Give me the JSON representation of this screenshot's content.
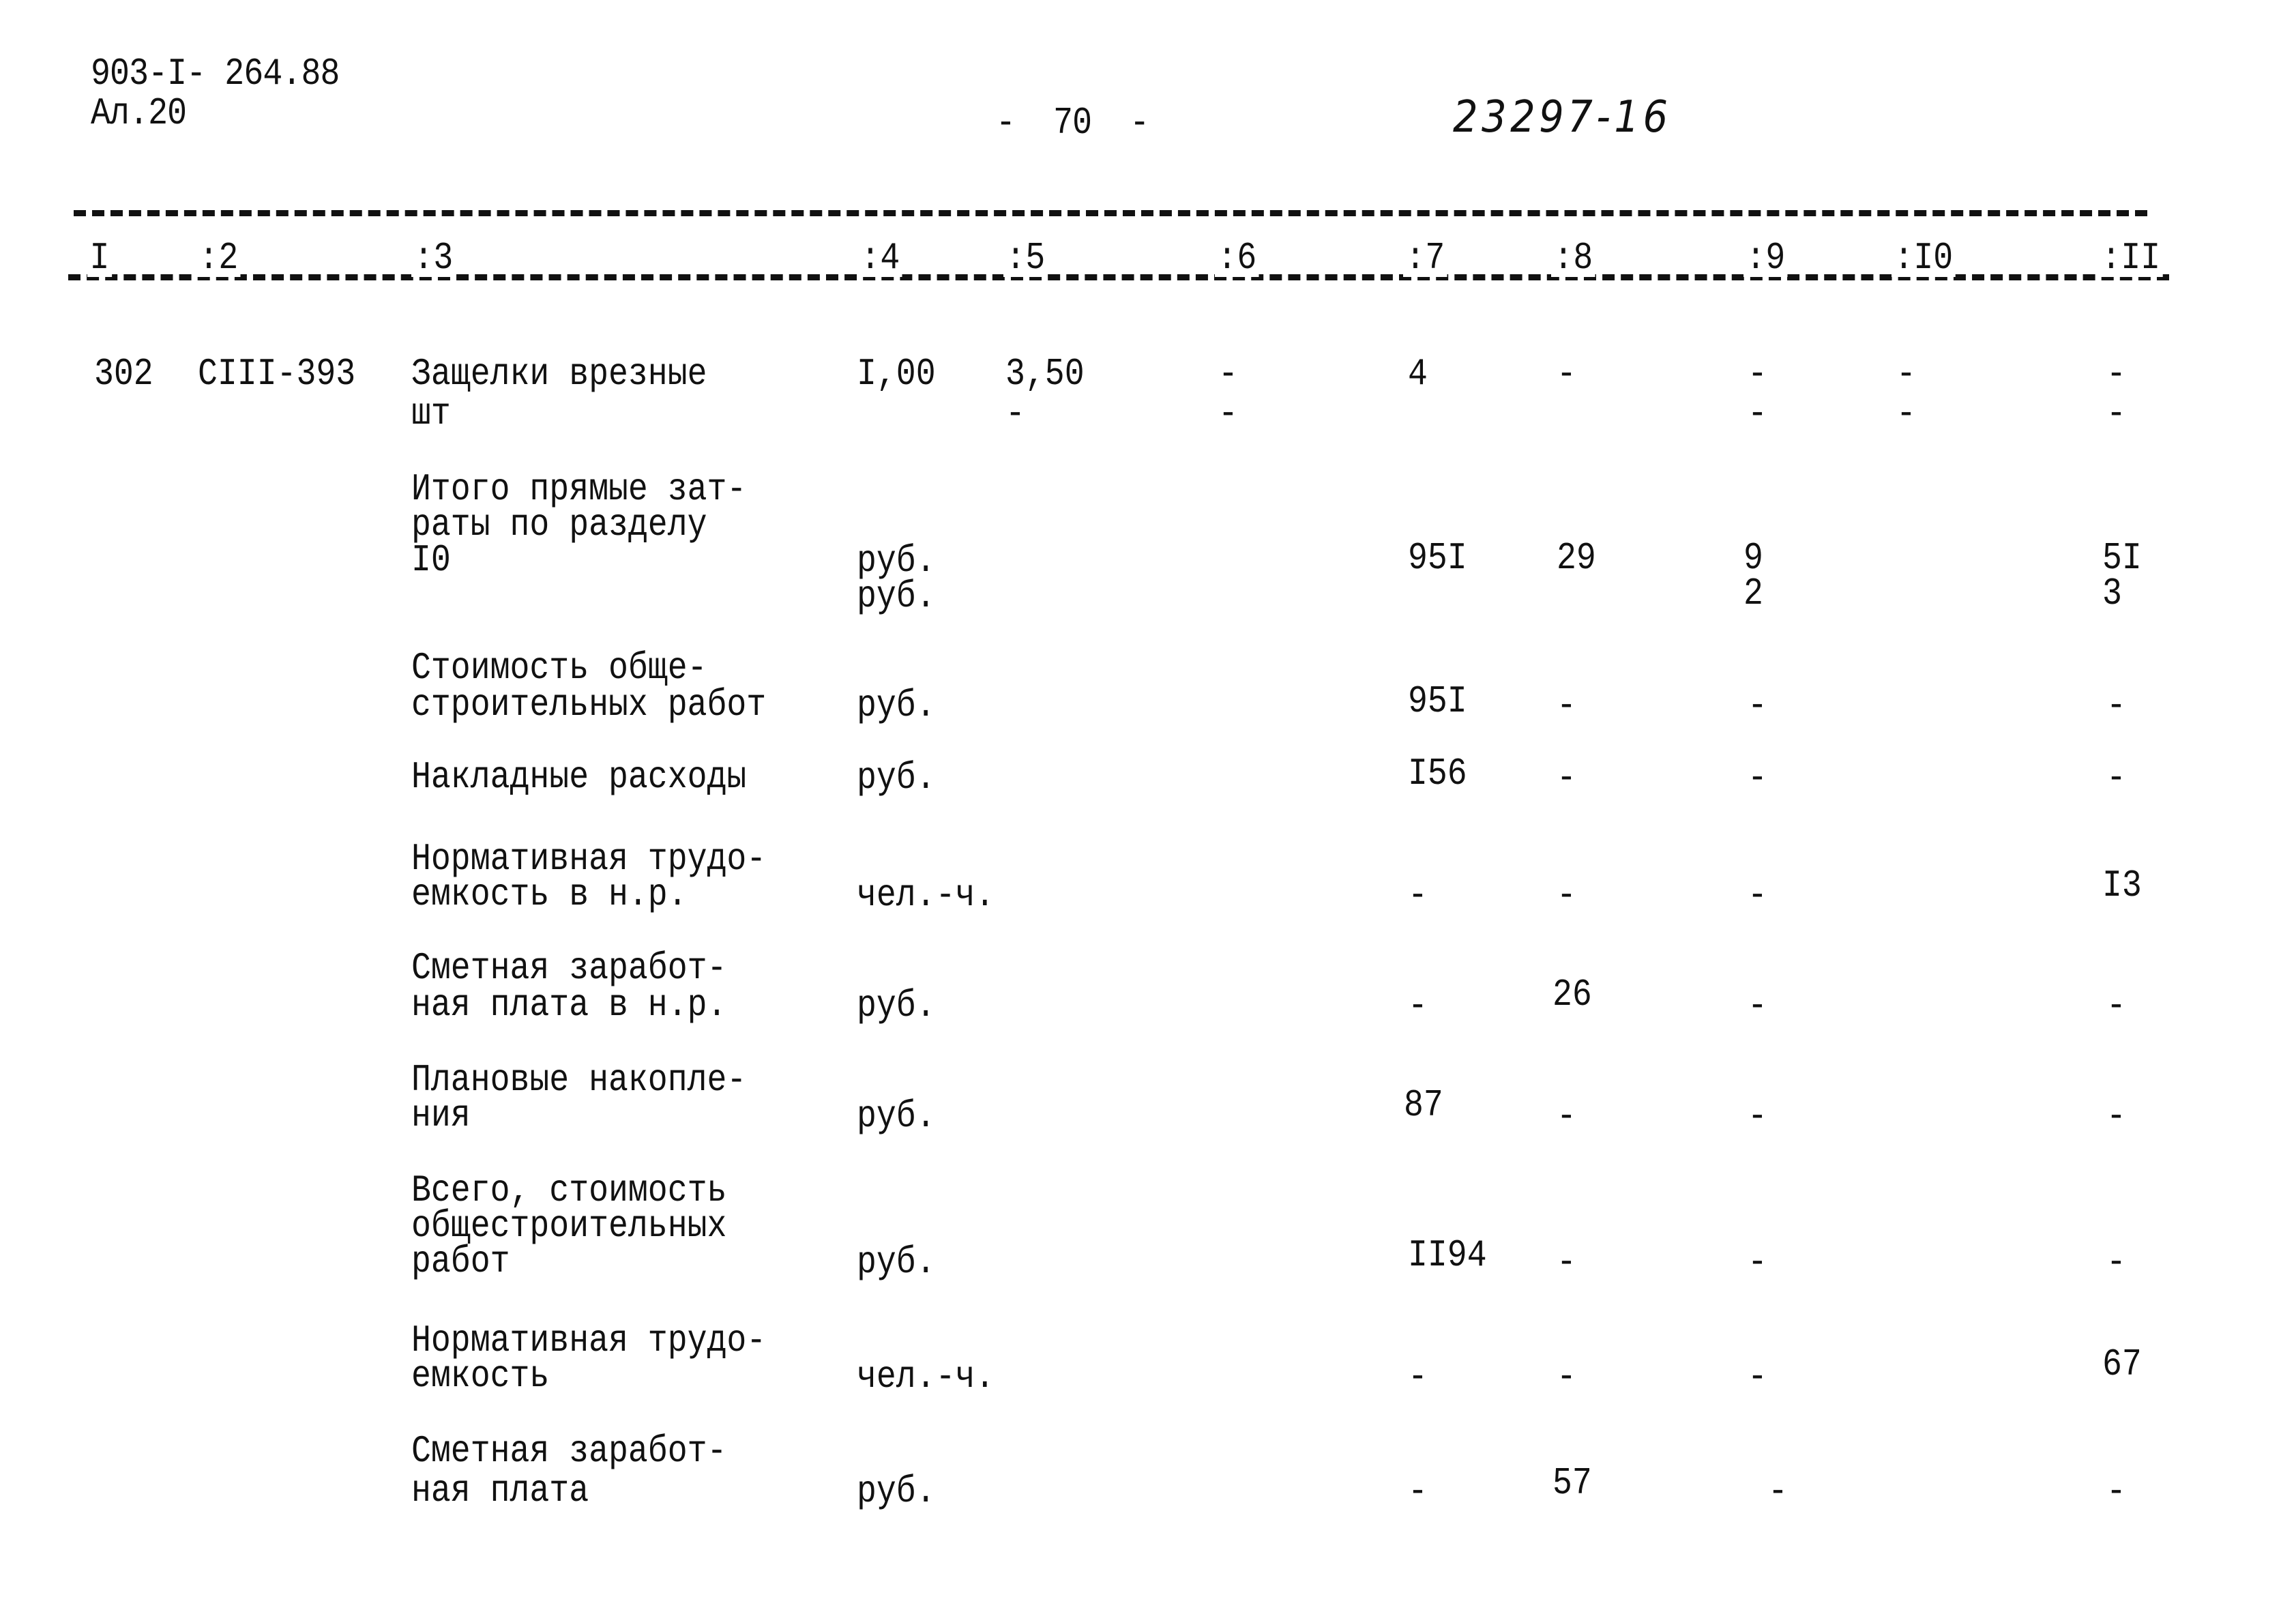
{
  "header": {
    "doc_code": "903-I- 264.88",
    "album": "Ал.20",
    "page_number": "-  70  -",
    "handwritten_number": "23297-16"
  },
  "columns": [
    ":I",
    ":2",
    ":3",
    ":4",
    ":5",
    ":6",
    ":7",
    ":8",
    ":9",
    ":I0",
    ":II"
  ],
  "column_labels": [
    "I",
    ":2",
    ":3",
    ":4",
    ":5",
    ":6",
    ":7",
    ":8",
    ":9",
    ":I0",
    ":II"
  ],
  "item": {
    "number": "302",
    "code": "СIII-393",
    "name_line1": "Защелки врезные",
    "name_line2": "шт",
    "c4": "I,00",
    "c5_top": "3,50",
    "c5_bottom": "-",
    "c6_top": "-",
    "c6_bottom": "-",
    "c7": "4",
    "c8": "-",
    "c9_top": "-",
    "c9_bottom": "-",
    "c10_top": "-",
    "c10_bottom": "-",
    "c11_top": "-",
    "c11_bottom": "-"
  },
  "summary_rows": [
    {
      "label": [
        "Итого прямые зат-",
        "раты по разделу",
        "I0"
      ],
      "unit": [
        "руб.",
        "руб."
      ],
      "c7": "95I",
      "c8": "29",
      "c9": [
        "9",
        "2"
      ],
      "c11": [
        "5I",
        "3"
      ]
    },
    {
      "label": [
        "Стоимость обще-",
        "строительных работ"
      ],
      "unit": "руб.",
      "c7": "95I",
      "c8": "-",
      "c9": "-",
      "c11": "-"
    },
    {
      "label": [
        "Накладные расходы"
      ],
      "unit": "руб.",
      "c7": "I56",
      "c8": "-",
      "c9": "-",
      "c11": "-"
    },
    {
      "label": [
        "Нормативная трудо-",
        "емкость в н.р."
      ],
      "unit": "чел.-ч.",
      "c7": "-",
      "c8": "-",
      "c9": "-",
      "c11": "I3"
    },
    {
      "label": [
        "Сметная заработ-",
        "ная плата в н.р."
      ],
      "unit": "руб.",
      "c7": "-",
      "c8": "26",
      "c9": "-",
      "c11": "-"
    },
    {
      "label": [
        "Плановые накопле-",
        "ния"
      ],
      "unit": "руб.",
      "c7": "87",
      "c8": "-",
      "c9": "-",
      "c11": "-"
    },
    {
      "label": [
        "Всего, стоимость",
        "общестроительных",
        "работ"
      ],
      "unit": "руб.",
      "c7": "II94",
      "c8": "-",
      "c9": "-",
      "c11": "-"
    },
    {
      "label": [
        "Нормативная трудо-",
        "емкость"
      ],
      "unit": "чел.-ч.",
      "c7": "-",
      "c8": "-",
      "c9": "-",
      "c11": "67"
    },
    {
      "label": [
        "Сметная заработ-",
        "ная плата"
      ],
      "unit": "руб.",
      "c7": "-",
      "c8": "57",
      "c9": "-",
      "c11": "-"
    }
  ]
}
